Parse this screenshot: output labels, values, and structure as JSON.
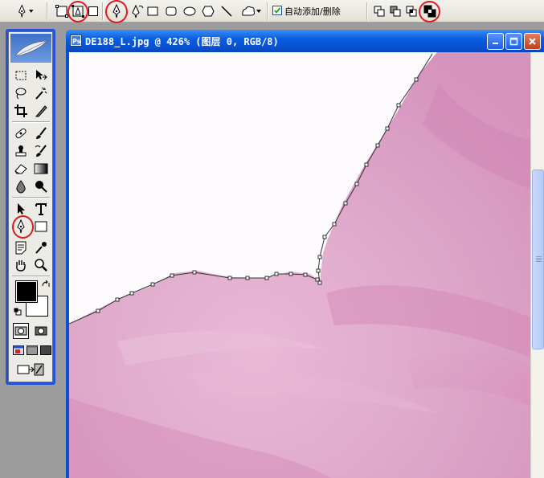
{
  "options_bar": {
    "tool_preset_icon": "pen-tool-icon",
    "mode_buttons": [
      {
        "name": "shape-layers-mode",
        "icon": "shape-layers-icon",
        "highlighted": false
      },
      {
        "name": "paths-mode",
        "icon": "paths-mode-icon",
        "highlighted": true
      },
      {
        "name": "fill-pixels-mode",
        "icon": "fill-pixels-icon",
        "highlighted": false
      }
    ],
    "shape_tools": [
      "pen-tool",
      "freeform-pen-tool",
      "rectangle-tool",
      "rounded-rectangle-tool",
      "ellipse-tool",
      "polygon-tool",
      "line-tool",
      "custom-shape-tool"
    ],
    "auto_add_delete": {
      "checked": true,
      "label": "自动添加/删除"
    },
    "path_area_buttons": [
      "add-to-path-area",
      "subtract-from-path-area",
      "intersect-path-areas",
      "exclude-overlapping-path-areas"
    ],
    "annotation_color": "#e0181b"
  },
  "toolbox": {
    "tools": [
      "rectangular-marquee",
      "move",
      "lasso",
      "magic-wand",
      "crop",
      "slice",
      "healing-brush",
      "brush",
      "clone-stamp",
      "history-brush",
      "eraser",
      "gradient",
      "blur",
      "dodge",
      "path-selection",
      "type",
      "pen",
      "rectangle",
      "notes",
      "eyedropper",
      "hand",
      "zoom"
    ],
    "active_tool": "pen",
    "foreground_color": "#000000",
    "background_color": "#ffffff"
  },
  "document": {
    "title": "DE188_L.jpg @ 426% (图层 0, RGB/8)",
    "petal_color": "#dca6c9",
    "background_color": "#fdfbfd"
  }
}
